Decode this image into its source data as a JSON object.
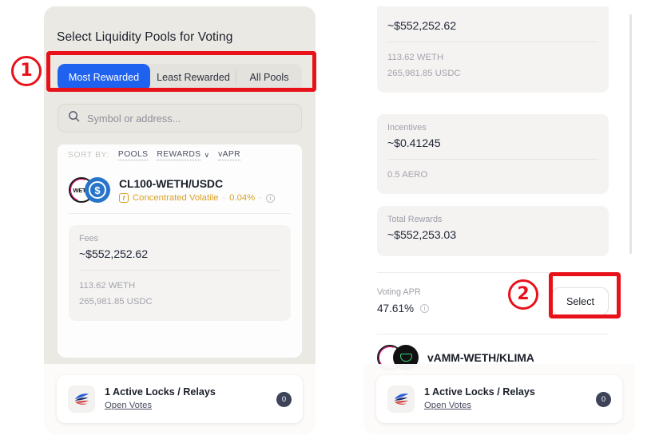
{
  "left_panel": {
    "title": "Select Liquidity Pools for Voting",
    "tabs": [
      {
        "label": "Most Rewarded",
        "active": true
      },
      {
        "label": "Least Rewarded",
        "active": false
      },
      {
        "label": "All Pools",
        "active": false
      }
    ],
    "search": {
      "placeholder": "Symbol or address...",
      "value": "",
      "icon": "search-icon"
    },
    "sort": {
      "label": "SORT BY:",
      "options": [
        "POOLS",
        "REWARDS",
        "vAPR"
      ],
      "caret": "∨"
    },
    "pool": {
      "name": "CL100-WETH/USDC",
      "type_badge_icon": "f-badge-icon",
      "type": "Concentrated Volatile",
      "fee": "0.04%",
      "info_icon": "info-circle-icon",
      "token_a": "WETH",
      "token_b": "USDC",
      "fees": {
        "label": "Fees",
        "value": "~$552,252.62",
        "lines": [
          "113.62 WETH",
          "265,981.85 USDC"
        ]
      }
    }
  },
  "right_panel": {
    "fees": {
      "value": "~$552,252.62",
      "lines": [
        "113.62 WETH",
        "265,981.85 USDC"
      ]
    },
    "incentives": {
      "label": "Incentives",
      "value": "~$0.41245",
      "lines": [
        "0.5 AERO"
      ]
    },
    "total_rewards": {
      "label": "Total Rewards",
      "value": "~$552,253.03"
    },
    "voting_apr": {
      "label": "Voting APR",
      "value": "47.61%",
      "info_icon": "info-circle-icon"
    },
    "select_button": "Select",
    "next_pool": {
      "name": "vAMM-WETH/KLIMA",
      "token_a": "WETH",
      "token_b": "KLIMA"
    }
  },
  "bottom_bar": {
    "logo_icon": "aerodrome-logo-icon",
    "title": "1 Active Locks / Relays",
    "link": "Open Votes",
    "count": "0"
  },
  "annotations": {
    "step_1": "1",
    "step_2": "2",
    "color": "#e8111a"
  },
  "colors": {
    "accent_blue": "#1f62f0",
    "panel_bg": "#ebe9e4",
    "card_bg": "#fdfdfd",
    "stat_bg": "#f4f3f1",
    "gold": "#d7a12a",
    "usdc_blue": "#2775ca",
    "weth_pink": "#e6007a",
    "klima_green": "#33d17a"
  }
}
